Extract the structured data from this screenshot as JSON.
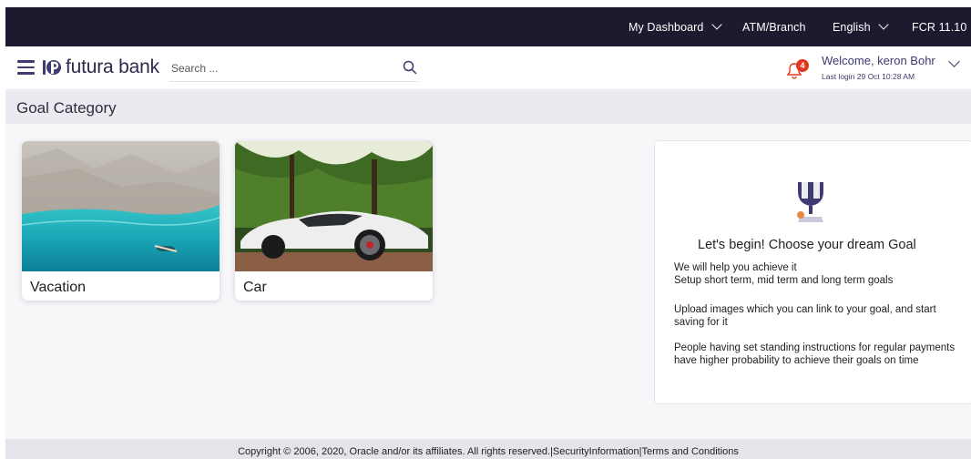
{
  "topbar": {
    "dashboard": "My Dashboard",
    "atm_branch": "ATM/Branch",
    "language": "English",
    "version": "FCR 11.10"
  },
  "header": {
    "brand": "futura bank",
    "search_placeholder": "Search ...",
    "notification_count": "4",
    "welcome": "Welcome, keron Bohr",
    "last_login": "Last login 29 Oct 10:28 AM"
  },
  "page": {
    "title": "Goal Category"
  },
  "goals": [
    {
      "label": "Vacation",
      "icon": "vacation-photo"
    },
    {
      "label": "Car",
      "icon": "car-photo"
    }
  ],
  "info": {
    "title": "Let's begin! Choose your dream Goal",
    "p1_line1": "We will help you achieve it",
    "p1_line2": "Setup short term, mid term and long term goals",
    "p2": "Upload images which you can link to your goal, and start saving for it",
    "p3": "People having set standing instructions for regular payments have higher probability to achieve their goals on time"
  },
  "footer": {
    "copyright": "Copyright © 2006, 2020, Oracle and/or its affiliates. All rights reserved.",
    "sep1": "|",
    "security": "SecurityInformation",
    "sep2": "|",
    "terms": "Terms and Conditions"
  },
  "colors": {
    "topbar_bg": "#1b1a2f",
    "brand_text": "#3d3b70",
    "badge": "#e2371e",
    "title_bar": "#eaeaf0"
  }
}
